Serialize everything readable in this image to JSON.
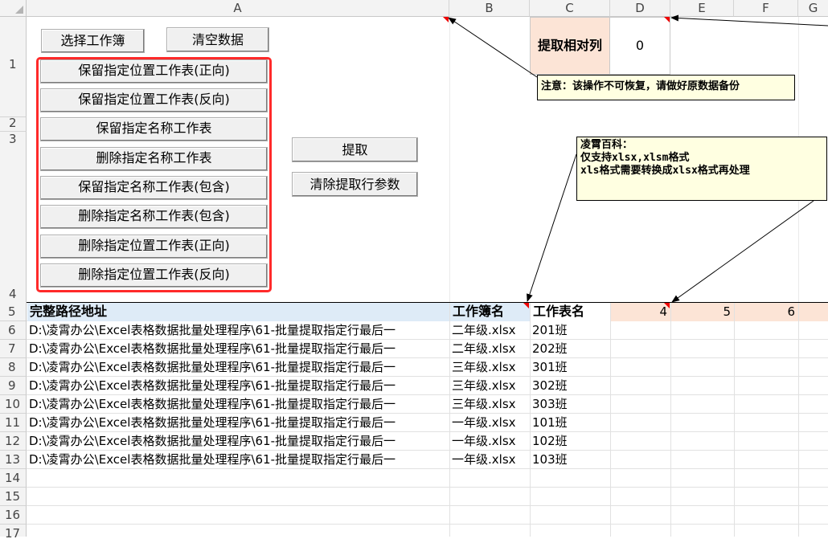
{
  "columns": [
    "A",
    "B",
    "C",
    "D",
    "E",
    "F",
    "G"
  ],
  "rows": [
    "1",
    "2",
    "3",
    "4",
    "5",
    "6",
    "7",
    "8",
    "9",
    "10",
    "11",
    "12",
    "13",
    "14",
    "15",
    "16",
    "17"
  ],
  "top_buttons": {
    "select": "选择工作簿",
    "clear": "清空数据"
  },
  "left_buttons": [
    "保留指定位置工作表(正向)",
    "保留指定位置工作表(反向)",
    "保留指定名称工作表",
    "删除指定名称工作表",
    "保留指定名称工作表(包含)",
    "删除指定名称工作表(包含)",
    "删除指定位置工作表(正向)",
    "删除指定位置工作表(反向)"
  ],
  "mid_buttons": {
    "extract": "提取",
    "clear_params": "清除提取行参数"
  },
  "param": {
    "label": "提取相对列",
    "value": "0"
  },
  "notes": {
    "warning": "注意：该操作不可恢复，请做好原数据备份",
    "info_line1": "凌霄百科：",
    "info_line2": "仅支持xlsx,xlsm格式",
    "info_line3": "xls格式需要转换成xlsx格式再处理"
  },
  "header_row": {
    "path": "完整路径地址",
    "workbook": "工作簿名",
    "sheet": "工作表名",
    "d": "4",
    "e": "5",
    "f": "6"
  },
  "data_rows": [
    {
      "path": "D:\\凌霄办公\\Excel表格数据批量处理程序\\61-批量提取指定行最后一",
      "workbook": "二年级.xlsx",
      "sheet": "201班"
    },
    {
      "path": "D:\\凌霄办公\\Excel表格数据批量处理程序\\61-批量提取指定行最后一",
      "workbook": "二年级.xlsx",
      "sheet": "202班"
    },
    {
      "path": "D:\\凌霄办公\\Excel表格数据批量处理程序\\61-批量提取指定行最后一",
      "workbook": "三年级.xlsx",
      "sheet": "301班"
    },
    {
      "path": "D:\\凌霄办公\\Excel表格数据批量处理程序\\61-批量提取指定行最后一",
      "workbook": "三年级.xlsx",
      "sheet": "302班"
    },
    {
      "path": "D:\\凌霄办公\\Excel表格数据批量处理程序\\61-批量提取指定行最后一",
      "workbook": "三年级.xlsx",
      "sheet": "303班"
    },
    {
      "path": "D:\\凌霄办公\\Excel表格数据批量处理程序\\61-批量提取指定行最后一",
      "workbook": "一年级.xlsx",
      "sheet": "101班"
    },
    {
      "path": "D:\\凌霄办公\\Excel表格数据批量处理程序\\61-批量提取指定行最后一",
      "workbook": "一年级.xlsx",
      "sheet": "102班"
    },
    {
      "path": "D:\\凌霄办公\\Excel表格数据批量处理程序\\61-批量提取指定行最后一",
      "workbook": "一年级.xlsx",
      "sheet": "103班"
    }
  ],
  "colors": {
    "header_blue": "#deebf7",
    "header_peach": "#fce4d6",
    "red_frame": "#ff2a2a",
    "note_bg": "#ffffe1"
  }
}
